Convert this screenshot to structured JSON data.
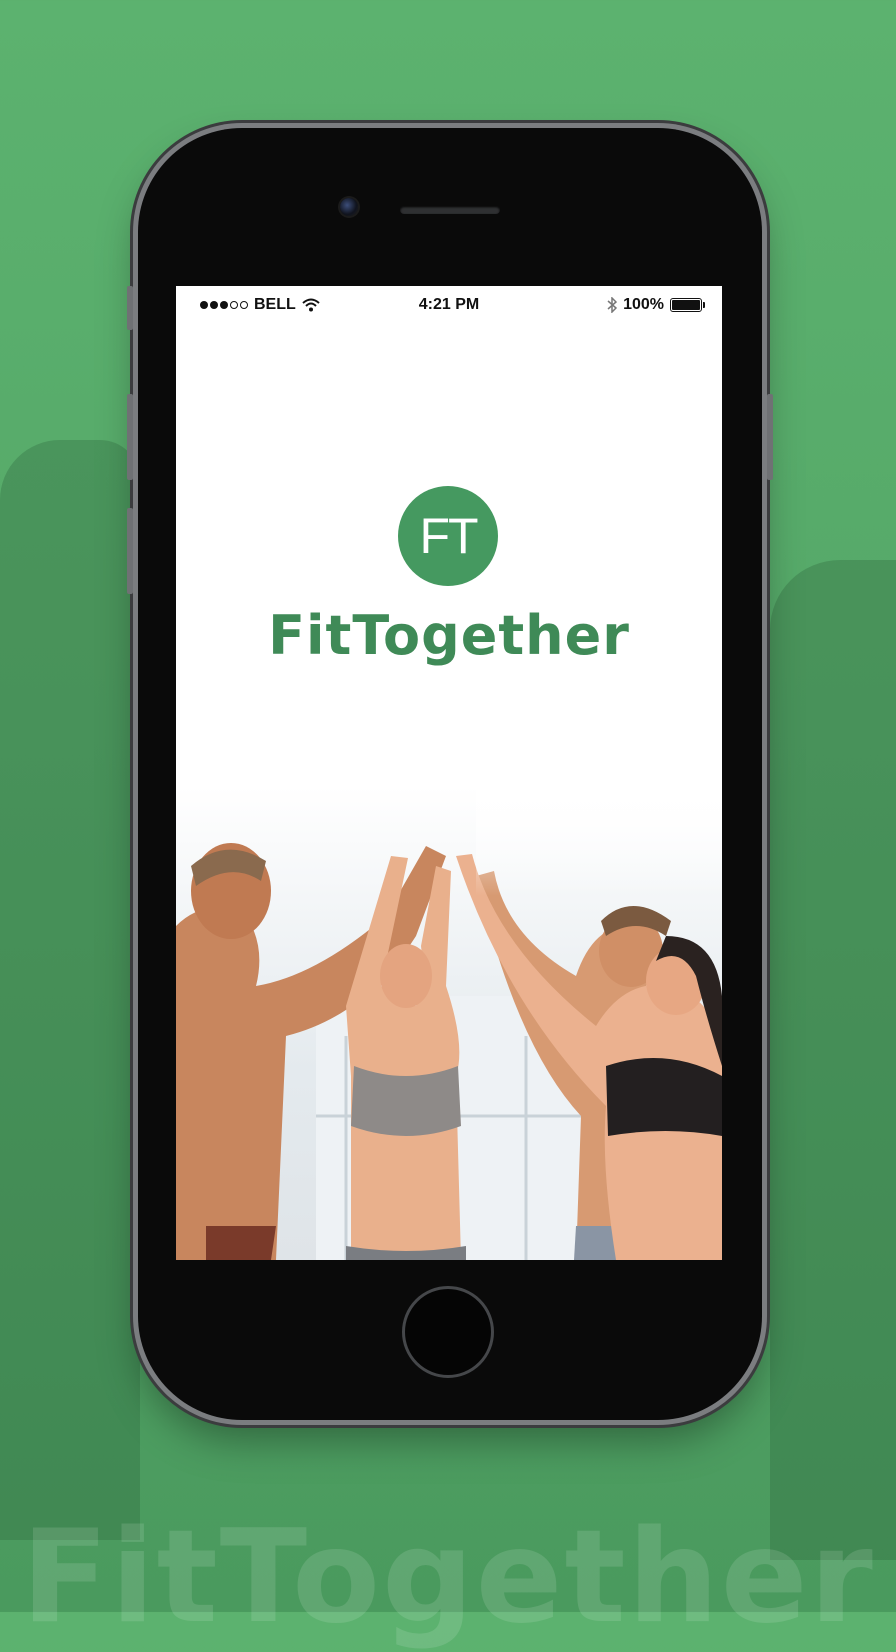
{
  "background": {
    "color": "#57ab6a",
    "watermark_text": "FitTogether"
  },
  "status_bar": {
    "signal_filled": 3,
    "signal_total": 5,
    "carrier": "BELL",
    "time": "4:21 PM",
    "battery_percent": "100%",
    "battery_level": 1.0,
    "icons": [
      "wifi-icon",
      "bluetooth-icon",
      "battery-icon"
    ]
  },
  "splash": {
    "logo_initials": "FT",
    "app_name": "FitTogether",
    "brand_color": "#459960",
    "hero_image": "group of four people giving a high five in a gym"
  }
}
